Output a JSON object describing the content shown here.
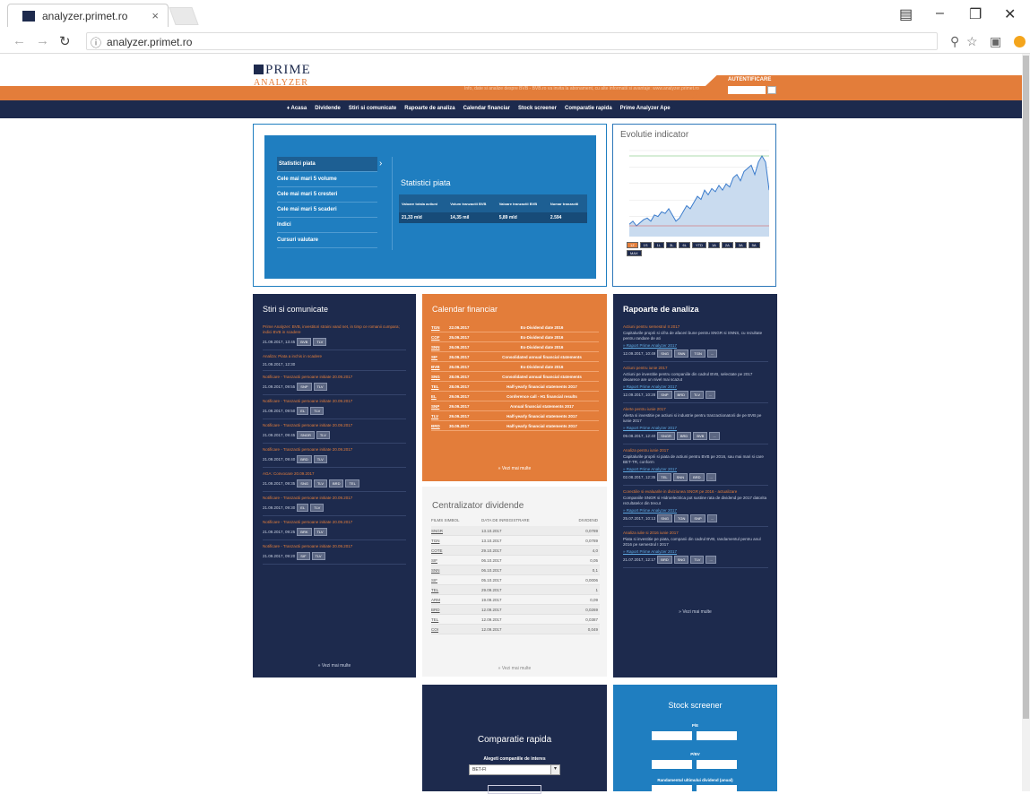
{
  "browser": {
    "tab_title": "analyzer.primet.ro",
    "tab_close": "×",
    "url": "analyzer.primet.ro",
    "controls": {
      "minimize": "–",
      "maximize": "❐",
      "close": "✕"
    }
  },
  "site": {
    "logo_top": "PRIME",
    "logo_bottom": "ANALYZER",
    "tagline": "Info, date si analize despre BVB - BVB.ro va invita la abonament, cu alte informatii si avantaje: www.analyzer.primet.ro",
    "login_label": "AUTENTIFICARE",
    "accent": "#e37d3a",
    "navy": "#1d2a4d",
    "blue": "#1f7ec0"
  },
  "nav": [
    "♦ Acasa",
    "Dividende",
    "Stiri si comunicate",
    "Rapoarte de analiza",
    "Calendar financiar",
    "Stock screener",
    "Comparatie rapida",
    "Prime Analyzer Ape"
  ],
  "market": {
    "menu": [
      "Statistici piata",
      "Cele mai mari 5 volume",
      "Cele mai mari 5 cresteri",
      "Cele mai mari 5 scaderi",
      "Indici",
      "Cursuri valutare"
    ],
    "title": "Statistici piata",
    "headers": [
      "Valoare totala actiuni",
      "Volum tranzactii BVB",
      "Valoare tranzactii BVB",
      "Numar tranzactii"
    ],
    "values": [
      "21,33 mld",
      "14,35 mil",
      "5,89 mld",
      "2.594"
    ]
  },
  "evolution": {
    "title": "Evolutie indicator",
    "ranges": [
      "1Z",
      "1S",
      "1L",
      "3L",
      "6L",
      "YTD",
      "1A",
      "2A",
      "3A",
      "5A",
      "MAX"
    ],
    "chart_data": {
      "type": "line",
      "values": [
        52,
        50,
        53,
        51,
        49,
        48,
        50,
        46,
        47,
        44,
        45,
        42,
        46,
        50,
        48,
        44,
        40,
        42,
        38,
        34,
        36,
        30,
        33,
        29,
        31,
        27,
        30,
        26,
        28,
        22,
        20,
        24,
        18,
        16,
        14,
        20,
        12,
        8,
        12,
        30
      ]
    }
  },
  "news": {
    "title": "Stiri si comunicate",
    "items": [
      {
        "title": "Prime Analyzer: BVB, investitori straini vand net, in timp ce romanii cumpara; indici BVB in scadere",
        "date": "21.09.2017, 13:45",
        "tags": [
          "BVB",
          "TLV"
        ]
      },
      {
        "title": "Analiza: Piata a inchis in scadere",
        "date": "21.09.2017, 12:30",
        "tags": []
      },
      {
        "title": "Notificare - Tranzactii persoane initiate 20.09.2017",
        "date": "21.09.2017, 09:55",
        "tags": [
          "SNP",
          "TLV"
        ]
      },
      {
        "title": "Notificare - Tranzactii persoane initiate 20.09.2017",
        "date": "21.09.2017, 09:50",
        "tags": [
          "EL",
          "TLV"
        ]
      },
      {
        "title": "Notificare - Tranzactii persoane initiate 20.09.2017",
        "date": "21.09.2017, 09:45",
        "tags": [
          "SNGR",
          "TLV"
        ]
      },
      {
        "title": "Notificare - Tranzactii persoane initiate 20.09.2017",
        "date": "21.09.2017, 09:40",
        "tags": [
          "BRD",
          "TLV"
        ]
      },
      {
        "title": "AGA: Convocare 20.09.2017",
        "date": "21.09.2017, 09:35",
        "tags": [
          "SNG",
          "TLV",
          "BRD",
          "TEL"
        ]
      },
      {
        "title": "Notificare - Tranzactii persoane initiate 20.09.2017",
        "date": "21.09.2017, 09:30",
        "tags": [
          "EL",
          "TLV"
        ]
      },
      {
        "title": "Notificare - Tranzactii persoane initiate 20.09.2017",
        "date": "21.09.2017, 09:25",
        "tags": [
          "BRK",
          "TLV"
        ]
      },
      {
        "title": "Notificare - Tranzactii persoane initiate 20.09.2017",
        "date": "21.09.2017, 09:20",
        "tags": [
          "SIF",
          "TLV"
        ]
      }
    ],
    "more": "» Vezi mai multe"
  },
  "calendar": {
    "title": "Calendar financiar",
    "rows": [
      {
        "sym": "TGN",
        "date": "22.09.2017",
        "event": "Ex-Dividend date 2016"
      },
      {
        "sym": "COF",
        "date": "25.09.2017",
        "event": "Ex-Dividend date 2016"
      },
      {
        "sym": "SNN",
        "date": "26.09.2017",
        "event": "Ex-Dividend date 2016"
      },
      {
        "sym": "SIF",
        "date": "26.09.2017",
        "event": "Consolidated annual financial statements"
      },
      {
        "sym": "BVB",
        "date": "26.09.2017",
        "event": "Ex-Dividend date 2016"
      },
      {
        "sym": "SNG",
        "date": "28.09.2017",
        "event": "Consolidated annual financial statements"
      },
      {
        "sym": "TEL",
        "date": "28.09.2017",
        "event": "Half-yearly financial statements 2017"
      },
      {
        "sym": "EL",
        "date": "29.09.2017",
        "event": "Conference call - H1 financial results"
      },
      {
        "sym": "SNP",
        "date": "29.09.2017",
        "event": "Annual financial statements 2017"
      },
      {
        "sym": "TLV",
        "date": "29.09.2017",
        "event": "Half-yearly financial statements 2017"
      },
      {
        "sym": "BRD",
        "date": "30.09.2017",
        "event": "Half-yearly financial statements 2017"
      }
    ],
    "more": "» Vezi mai multe"
  },
  "dividends": {
    "title": "Centralizator dividende",
    "headers": [
      "FILMS SIMBOL",
      "DATA DE INREGISTRARE",
      "DIVIDEND"
    ],
    "rows": [
      [
        "SNGR",
        "13.10.2017",
        "0,0789"
      ],
      [
        "TGN",
        "13.10.2017",
        "0,0789"
      ],
      [
        "COTE",
        "29.10.2017",
        "4,0"
      ],
      [
        "SIF",
        "06.10.2017",
        "0,05"
      ],
      [
        "SNN",
        "06.10.2017",
        "0,1"
      ],
      [
        "SIF",
        "05.10.2017",
        "0,0006"
      ],
      [
        "TEL",
        "29.09.2017",
        "1"
      ],
      [
        "ARM",
        "19.09.2017",
        "0,09"
      ],
      [
        "BRD",
        "12.09.2017",
        "0,0269"
      ],
      [
        "TEL",
        "12.09.2017",
        "0,0387"
      ],
      [
        "COI",
        "12.09.2017",
        "0,049"
      ]
    ],
    "more": "» Vezi mai multe"
  },
  "reports": {
    "title": "Rapoarte de analiza",
    "items": [
      {
        "title": "Actiuni pentru semestrul II 2017",
        "body": "Capitalurile proprii si cifra de afaceri bune pentru SNGR si SNNS, cu rezultate pentru randare de ati",
        "link": "» Raport Prime Analyzer 2017",
        "date": "12.09.2017, 10:49",
        "tags": [
          "SNG",
          "SNN",
          "TGN",
          "..."
        ]
      },
      {
        "title": "Actiuni pentru iunie 2017",
        "body": "Actiuni pe investitie pentru companiile din cadrul BVB, selectate pe 2017 deoarece are un nivel mai scazut",
        "link": "» Raport Prime Analyzer 2017",
        "date": "12.09.2017, 10:28",
        "tags": [
          "SNP",
          "BRD",
          "TLV",
          "..."
        ]
      },
      {
        "title": "Alerte pentru iunie 2017",
        "body": "Alerta si investitie pe actiuni si industrie pentru tranzactionatorii de pe BVB pe iunie 2017",
        "link": "» Raport Prime Analyzer 2017",
        "date": "09.08.2017, 12:40",
        "tags": [
          "SNGR",
          "BRD",
          "BVB",
          "..."
        ]
      },
      {
        "title": "Analiza pentru iunie 2017",
        "body": "Capitalurile proprii si piata de actiuni pentru BVB pe 2016, sau mai mari si care BET-TR, conform",
        "link": "» Raport Prime Analyzer 2017",
        "date": "02.08.2017, 12:35",
        "tags": [
          "TEL",
          "SNN",
          "BRD",
          "..."
        ]
      },
      {
        "title": "Corectiile si evaluarile in diviziunea SNGR pe 2016 - actualizare",
        "body": "Companiile SNGR si Hidroelectrica pot sustine rata de dividend pe 2017 datorita rezultatelor din trecut",
        "link": "» Raport Prime Analyzer 2017",
        "date": "25.07.2017, 10:13",
        "tags": [
          "SNG",
          "TGN",
          "SNP",
          "..."
        ]
      },
      {
        "title": "Analiza iulie si 2016 iunie 2017",
        "body": "Piata si investitie pe piata, companii din cadrul BVB, randamentul pentru anul 2016 pe semestrul I 2017",
        "link": "» Raport Prime Analyzer 2017",
        "date": "21.07.2017, 12:17",
        "tags": [
          "BRD",
          "SNG",
          "TLV",
          "..."
        ]
      }
    ],
    "more": "» Vezi mai multe"
  },
  "compare": {
    "title": "Comparatie rapida",
    "label": "Alegeti companiile de interes",
    "selected": "BET-FI"
  },
  "screener": {
    "title": "Stock screener",
    "fields": [
      "P/E",
      "P/BV",
      "Randamentul ultimului dividend (anual)"
    ]
  }
}
